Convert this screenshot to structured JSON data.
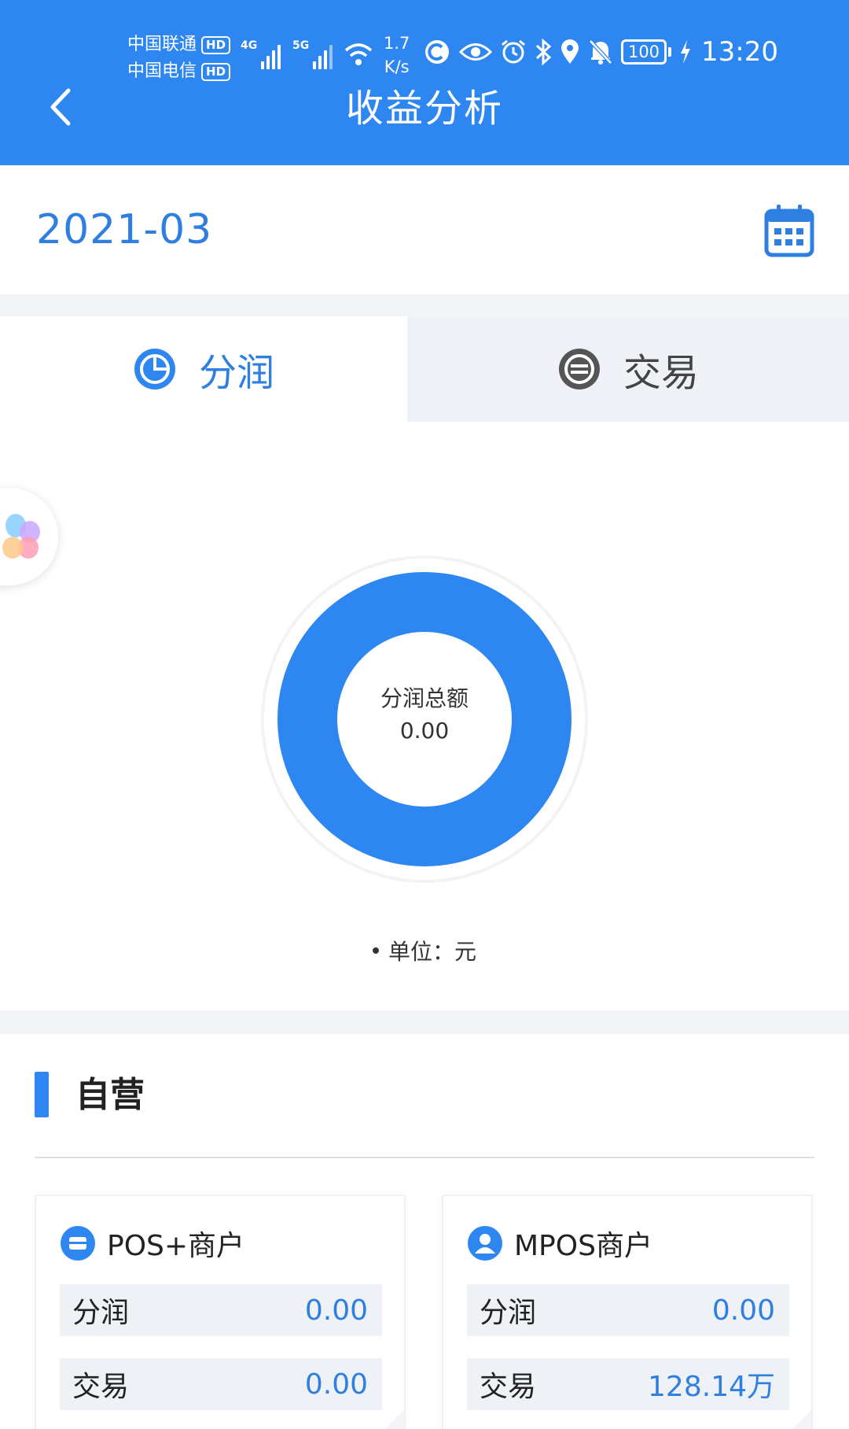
{
  "status_bar": {
    "carrier_1": "中国联通",
    "carrier_2": "中国电信",
    "hd": "HD",
    "net_1": "4G",
    "net_2": "5G",
    "speed_value": "1.7",
    "speed_unit": "K/s",
    "battery": "100",
    "time": "13:20"
  },
  "header": {
    "title": "收益分析"
  },
  "date": {
    "value": "2021-03"
  },
  "tabs": [
    {
      "label": "分润",
      "active": true
    },
    {
      "label": "交易",
      "active": false
    }
  ],
  "chart_data": {
    "type": "pie",
    "title": "分润总额",
    "total": "0.00",
    "legend": "单位：元",
    "color": "#2e86f0"
  },
  "section": {
    "title": "自营",
    "cards": [
      {
        "title": "POS+商户",
        "rows": [
          {
            "label": "分润",
            "value": "0.00"
          },
          {
            "label": "交易",
            "value": "0.00"
          }
        ]
      },
      {
        "title": "MPOS商户",
        "rows": [
          {
            "label": "分润",
            "value": "0.00"
          },
          {
            "label": "交易",
            "value": "128.14万"
          }
        ]
      }
    ]
  },
  "colors": {
    "primary": "#2e86f0",
    "value_blue": "#2f7fe0",
    "tab_inactive_bg": "#eef1f6"
  },
  "icons": [
    "back-icon",
    "calendar-icon",
    "pie-chart-icon",
    "list-icon",
    "card-icon",
    "user-icon"
  ]
}
